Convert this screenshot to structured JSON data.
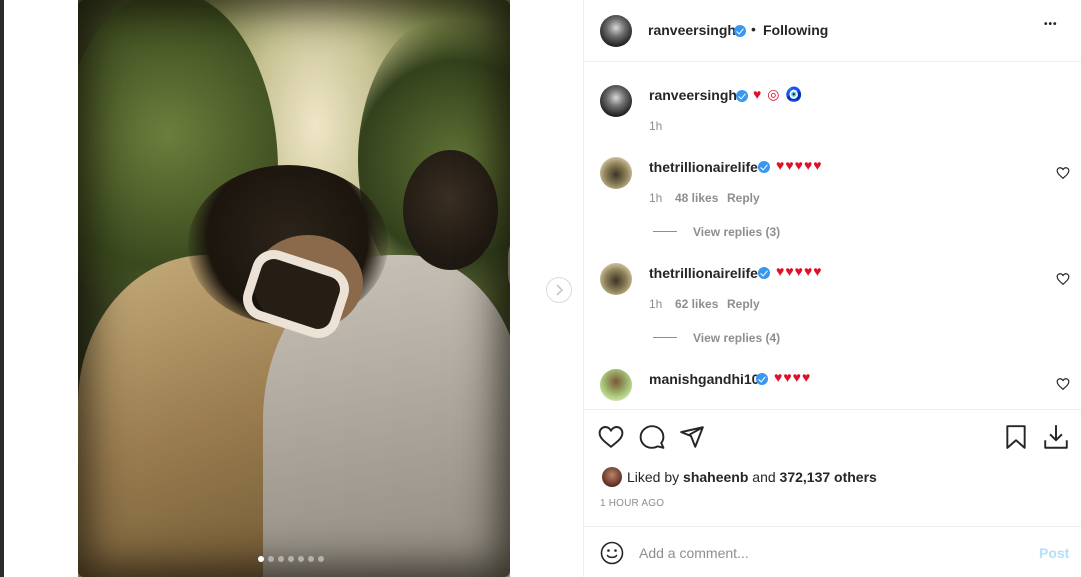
{
  "post": {
    "dots_count": 7,
    "active_dot": 0
  },
  "header": {
    "username": "ranveersingh",
    "bullet": "•",
    "following": "Following",
    "more": "•••"
  },
  "caption": {
    "username": "ranveersingh",
    "text": "♥ ◎ 🧿",
    "time": "1h"
  },
  "comments": [
    {
      "username": "thetrillionairelife",
      "text": "♥♥♥♥♥",
      "time": "1h",
      "likes": "48 likes",
      "reply": "Reply",
      "view_replies": "View replies (3)"
    },
    {
      "username": "thetrillionairelife",
      "text": "♥♥♥♥♥",
      "time": "1h",
      "likes": "62 likes",
      "reply": "Reply",
      "view_replies": "View replies (4)"
    },
    {
      "username": "manishgandhi10",
      "text": "♥♥♥♥"
    }
  ],
  "likes": {
    "prefix": "Liked by",
    "user": "shaheenb",
    "connector": "and",
    "others": "372,137 others"
  },
  "timestamp": "1 HOUR AGO",
  "comment_box": {
    "placeholder": "Add a comment...",
    "post_label": "Post"
  },
  "colors": {
    "heart": "#e0102a",
    "verified": "#3897f0",
    "post_disabled": "#b2dffc",
    "muted": "#8e8e8e"
  }
}
